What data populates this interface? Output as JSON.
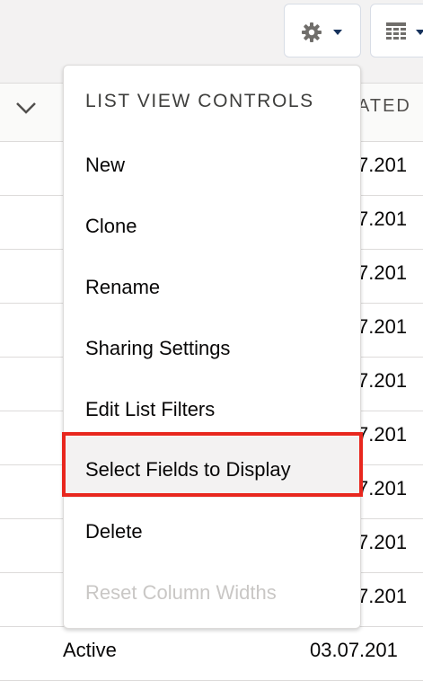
{
  "toolbar": {
    "gear_icon": "gear-icon",
    "table_icon": "table-icon"
  },
  "table": {
    "column_partial_title": "ATED",
    "rows": [
      {
        "date": "7.201"
      },
      {
        "date": "7.201"
      },
      {
        "date": "7.201"
      },
      {
        "date": "7.201"
      },
      {
        "date": "7.201"
      },
      {
        "date": "7.201"
      },
      {
        "date": "7.201"
      },
      {
        "date": "7.201"
      },
      {
        "date": "7.201"
      }
    ],
    "last_row": {
      "status": "Active",
      "date": "03.07.201"
    }
  },
  "menu": {
    "header": "LIST VIEW CONTROLS",
    "items": [
      {
        "label": "New"
      },
      {
        "label": "Clone"
      },
      {
        "label": "Rename"
      },
      {
        "label": "Sharing Settings"
      },
      {
        "label": "Edit List Filters"
      },
      {
        "label": "Select Fields to Display"
      },
      {
        "label": "Delete"
      },
      {
        "label": "Reset Column Widths"
      }
    ]
  },
  "colors": {
    "highlight": "#e8271e",
    "disabled_text": "#c9c7c5"
  }
}
